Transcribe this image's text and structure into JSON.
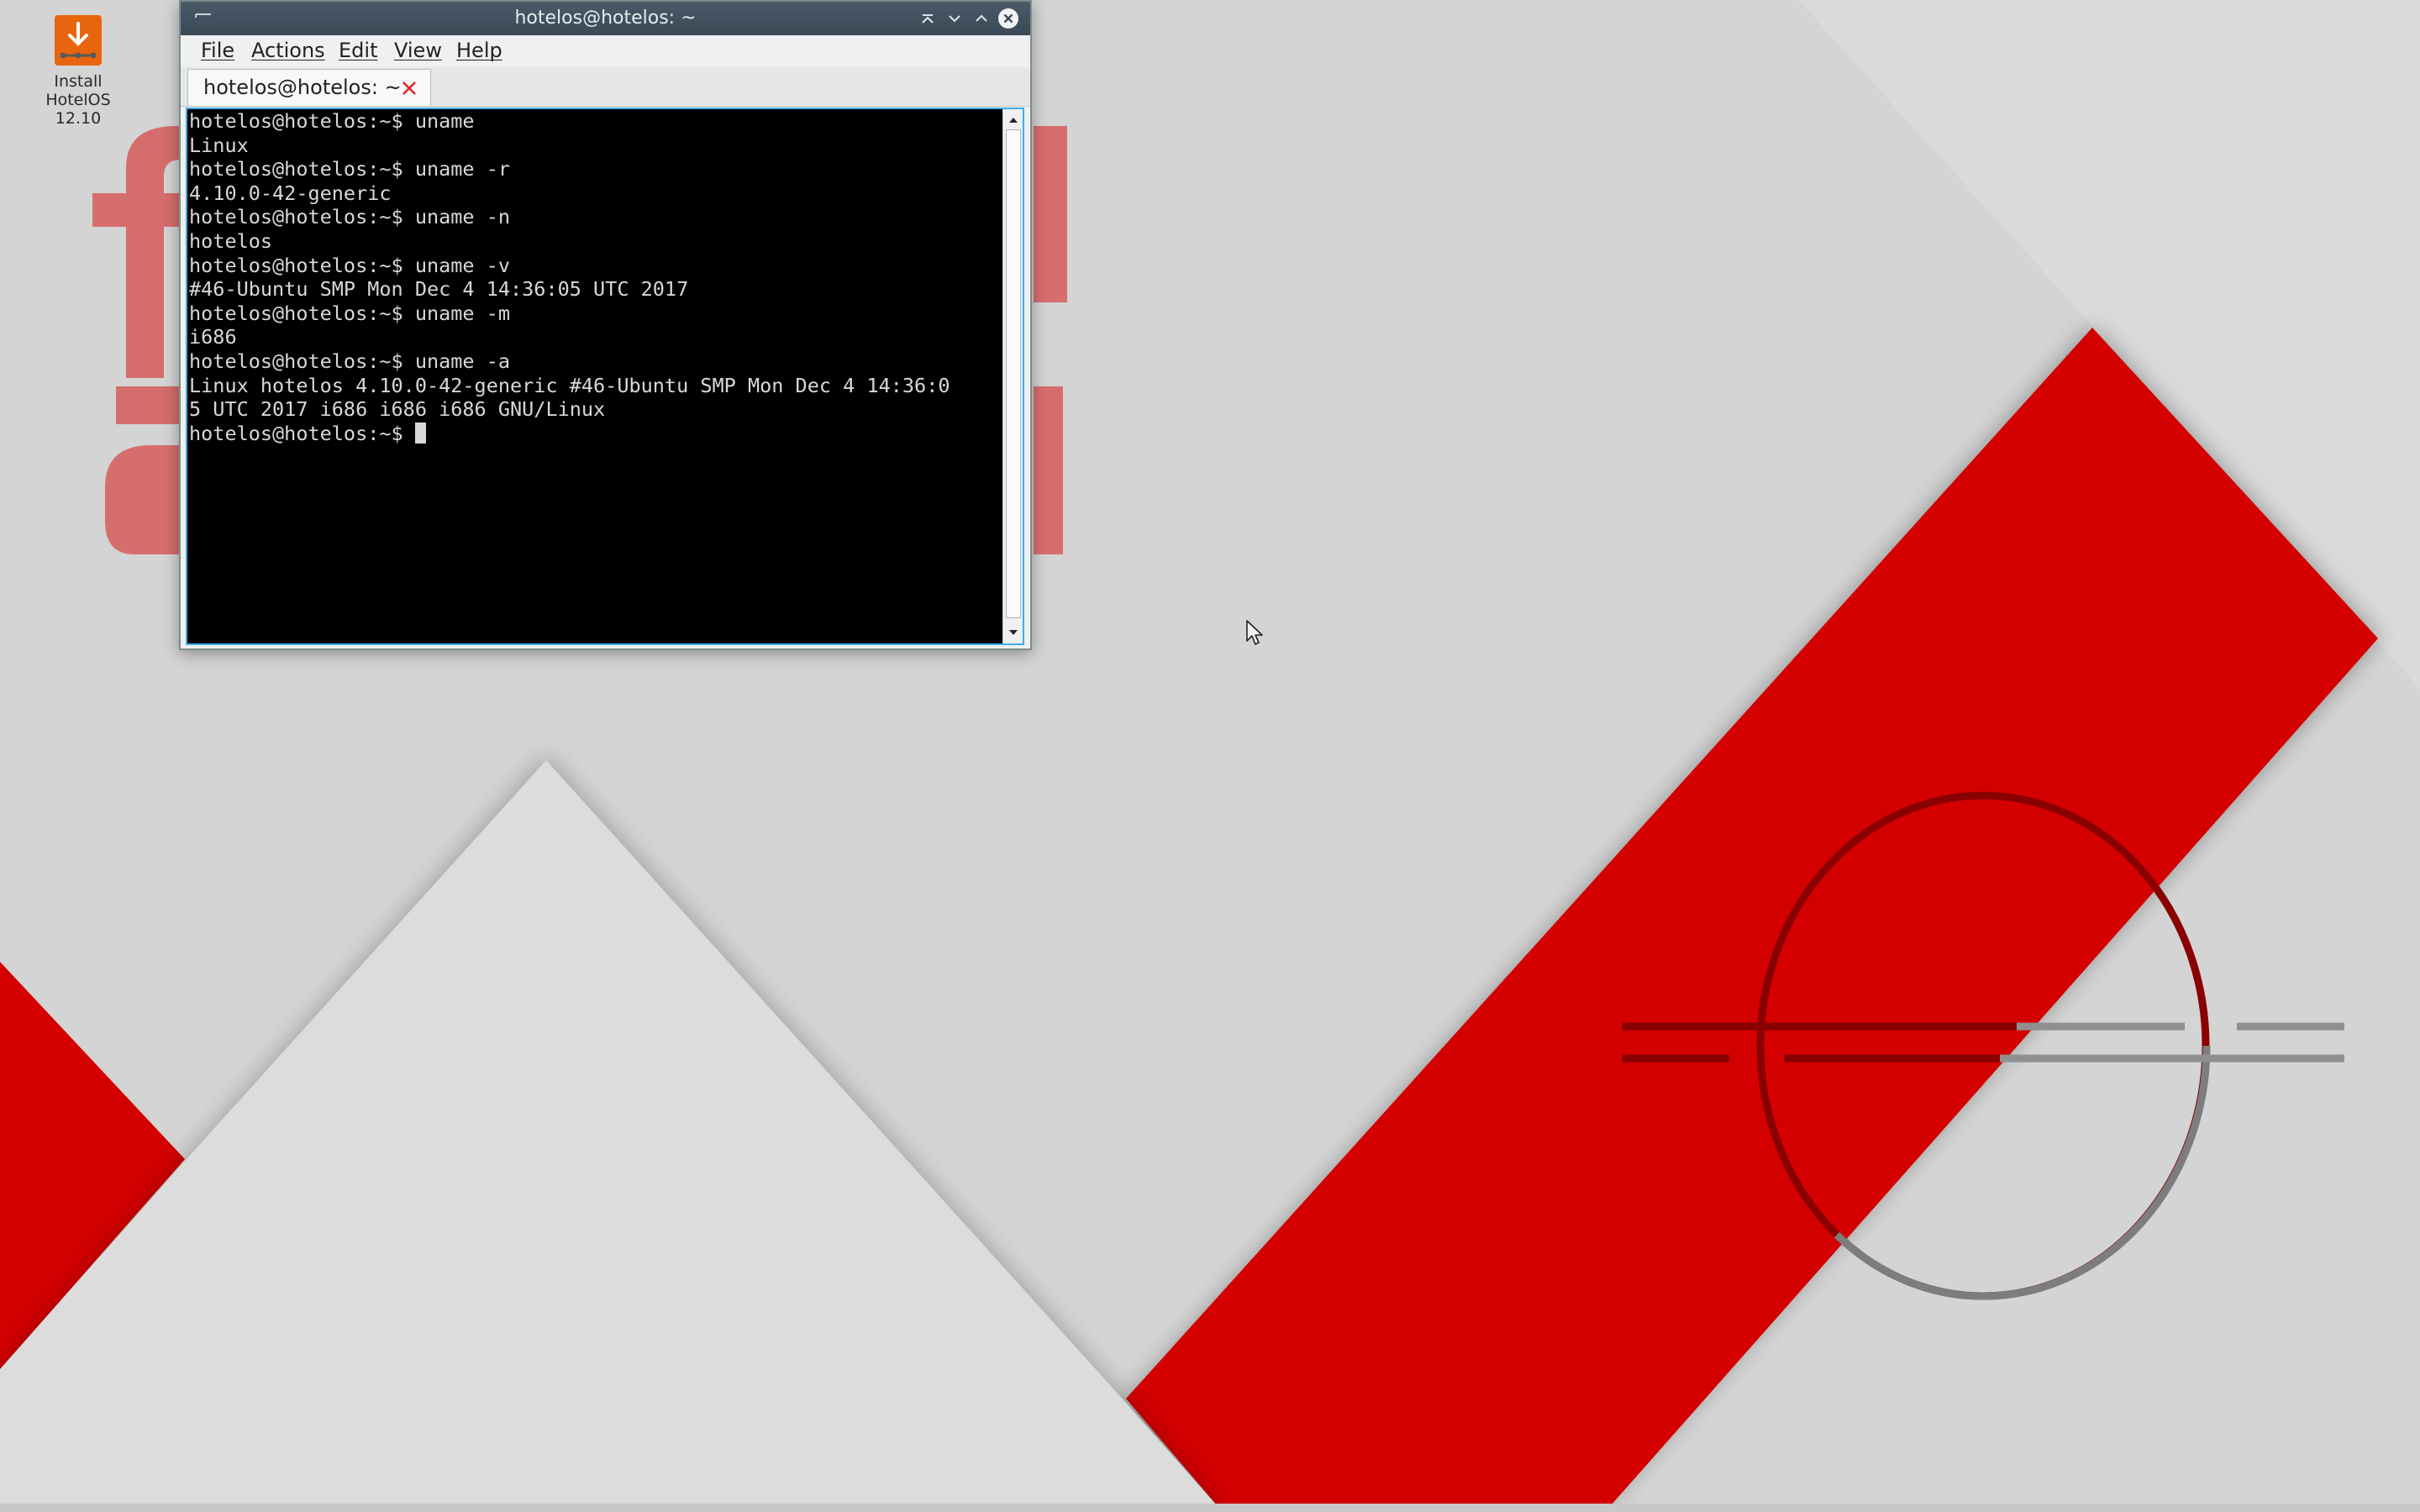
{
  "desktop": {
    "icon": {
      "name": "install-icon",
      "label": "Install\nHotelOS\n12.10",
      "color": "#e8650f"
    },
    "wallpaper": {
      "accent": "#d40000",
      "base": "#d6d6d6",
      "logo_text_color": "#d66a6a"
    }
  },
  "window": {
    "title": "hotelos@hotelos: ~",
    "titlebar_color": "#3b4956",
    "focus_color": "#3daee9",
    "menu": [
      "File",
      "Actions",
      "Edit",
      "View",
      "Help"
    ],
    "tab": {
      "label": "hotelos@hotelos: ~",
      "close_icon": "close-icon",
      "close_color": "#e02424"
    },
    "buttons": [
      "keep-above-icon",
      "minimize-icon",
      "maximize-icon",
      "close-icon"
    ]
  },
  "terminal": {
    "lines": [
      "hotelos@hotelos:~$ uname",
      "Linux",
      "hotelos@hotelos:~$ uname -r",
      "4.10.0-42-generic",
      "hotelos@hotelos:~$ uname -n",
      "hotelos",
      "hotelos@hotelos:~$ uname -v",
      "#46-Ubuntu SMP Mon Dec 4 14:36:05 UTC 2017",
      "hotelos@hotelos:~$ uname -m",
      "i686",
      "hotelos@hotelos:~$ uname -a",
      "Linux hotelos 4.10.0-42-generic #46-Ubuntu SMP Mon Dec 4 14:36:0",
      "5 UTC 2017 i686 i686 i686 GNU/Linux"
    ],
    "prompt": "hotelos@hotelos:~$ "
  }
}
